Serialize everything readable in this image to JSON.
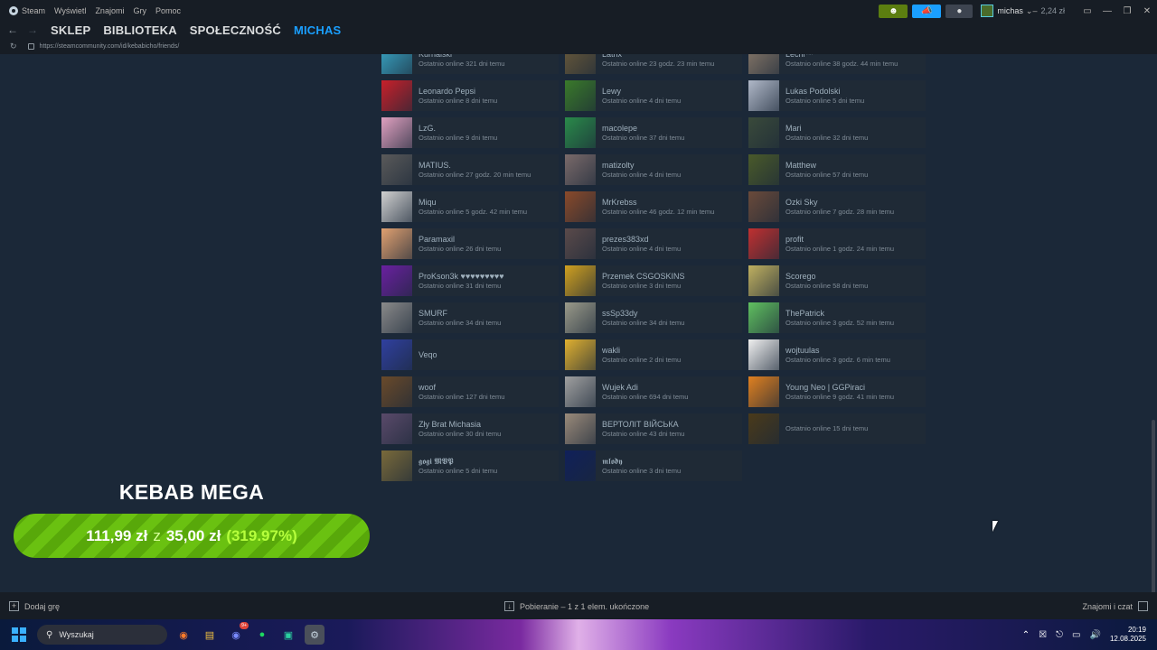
{
  "menubar": {
    "app_name": "Steam",
    "items": [
      "Wyświetl",
      "Znajomi",
      "Gry",
      "Pomoc"
    ]
  },
  "titlebar": {
    "username": "michas",
    "balance": "2,24 zł",
    "icons": [
      "friends-icon",
      "announcement-icon",
      "bell-icon",
      "monitor-icon",
      "minimize-icon",
      "restore-icon",
      "close-icon"
    ]
  },
  "nav": {
    "links": [
      "SKLEP",
      "BIBLIOTEKA",
      "SPOŁECZNOŚĆ",
      "MICHAS"
    ],
    "active": "MICHAS",
    "url": "https://steamcommunity.com/id/kebabicho/friends/"
  },
  "friends": [
    {
      "name": "Kurnalski",
      "status": "Ostatnio online 321 dni temu",
      "color": "#3aa8c8"
    },
    {
      "name": "Latrix",
      "status": "Ostatnio online 23 godz. 23 min temu",
      "color": "#6a5a3a"
    },
    {
      "name": "Lechi™",
      "status": "Ostatnio online 38 godz. 44 min temu",
      "color": "#8a7a6a"
    },
    {
      "name": "Leonardo Pepsi",
      "status": "Ostatnio online 8 dni temu",
      "color": "#c8202a"
    },
    {
      "name": "Lewy",
      "status": "Ostatnio online 4 dni temu",
      "color": "#3a7a2a"
    },
    {
      "name": "Lukas Podolski",
      "status": "Ostatnio online 5 dni temu",
      "color": "#b0b8c8"
    },
    {
      "name": "LzG.",
      "status": "Ostatnio online 9 dni temu",
      "color": "#e0a0c0"
    },
    {
      "name": "macolepe",
      "status": "Ostatnio online 37 dni temu",
      "color": "#2a8a4a"
    },
    {
      "name": "Mari",
      "status": "Ostatnio online 32 dni temu",
      "color": "#3a4a3a"
    },
    {
      "name": "MATIUS.",
      "status": "Ostatnio online 27 godz. 20 min temu",
      "color": "#5a5a5a"
    },
    {
      "name": "matizolty",
      "status": "Ostatnio online 4 dni temu",
      "color": "#7a6a6a"
    },
    {
      "name": "Matthew",
      "status": "Ostatnio online 57 dni temu",
      "color": "#4a5a2a"
    },
    {
      "name": "Miqu",
      "status": "Ostatnio online 5 godz. 42 min temu",
      "color": "#d0d0d0"
    },
    {
      "name": "MrKrebss",
      "status": "Ostatnio online 46 godz. 12 min temu",
      "color": "#8a4a2a"
    },
    {
      "name": "Ozki Sky",
      "status": "Ostatnio online 7 godz. 28 min temu",
      "color": "#6a4a3a"
    },
    {
      "name": "Paramaxil",
      "status": "Ostatnio online 26 dni temu",
      "color": "#e0a070"
    },
    {
      "name": "prezes383xd",
      "status": "Ostatnio online 4 dni temu",
      "color": "#5a4a4a"
    },
    {
      "name": "profit",
      "status": "Ostatnio online 1 godz. 24 min temu",
      "color": "#c03030"
    },
    {
      "name": "ProKson3k ♥♥♥♥♥♥♥♥♥",
      "status": "Ostatnio online 31 dni temu",
      "color": "#6a20a0"
    },
    {
      "name": "Przemek CSGOSKINS",
      "status": "Ostatnio online 3 dni temu",
      "color": "#d0a020"
    },
    {
      "name": "Scorego",
      "status": "Ostatnio online 58 dni temu",
      "color": "#c0b060"
    },
    {
      "name": "SMURF",
      "status": "Ostatnio online 34 dni temu",
      "color": "#8a8a8a"
    },
    {
      "name": "ssSp33dy",
      "status": "Ostatnio online 34 dni temu",
      "color": "#9a9a8a"
    },
    {
      "name": "ThePatrick",
      "status": "Ostatnio online 3 godz. 52 min temu",
      "color": "#60c060"
    },
    {
      "name": "Veqo",
      "status": "",
      "color": "#3040a0"
    },
    {
      "name": "wakli",
      "status": "Ostatnio online 2 dni temu",
      "color": "#e0b030"
    },
    {
      "name": "wojtuulas",
      "status": "Ostatnio online 3 godz. 6 min temu",
      "color": "#f0f0f0"
    },
    {
      "name": "woof",
      "status": "Ostatnio online 127 dni temu",
      "color": "#6a4a2a"
    },
    {
      "name": "Wujek Adi",
      "status": "Ostatnio online 694 dni temu",
      "color": "#a0a0a0"
    },
    {
      "name": "Young Neo | GGPiraci",
      "status": "Ostatnio online 9 godz. 41 min temu",
      "color": "#e08020"
    },
    {
      "name": "Zły Brat Michasia",
      "status": "Ostatnio online 30 dni temu",
      "color": "#5a4a6a"
    },
    {
      "name": "ВЕРТОЛІТ ВІЙСЬКА",
      "status": "Ostatnio online 43 dni temu",
      "color": "#9a8a7a"
    },
    {
      "name": "",
      "status": "Ostatnio online 15 dni temu",
      "color": "#4a3a1a"
    },
    {
      "name": "𝖌𝖔𝖌𝖎 𝕸𝖁𝕻",
      "status": "Ostatnio online 5 dni temu",
      "color": "#7a6a3a"
    },
    {
      "name": "𝖒𝖑𝖔𝖉𝖞",
      "status": "Ostatnio online 3 dni temu",
      "color": "#10205a"
    }
  ],
  "kebab": {
    "title": "KEBAB MEGA",
    "current": "111,99 zł",
    "separator": "z",
    "goal": "35,00 zł",
    "percent": "(319.97%)"
  },
  "bottombar": {
    "add_game": "Dodaj grę",
    "downloads": "Pobieranie – 1 z 1 elem. ukończone",
    "friends_chat": "Znajomi i czat"
  },
  "taskbar": {
    "search_label": "Wyszukaj",
    "discord_badge": "9+",
    "time": "20:19",
    "date": "12.08.2025",
    "apps": [
      "firefox-icon",
      "file-explorer-icon",
      "discord-icon",
      "spotify-icon",
      "robot-app-icon",
      "steam-icon"
    ]
  }
}
